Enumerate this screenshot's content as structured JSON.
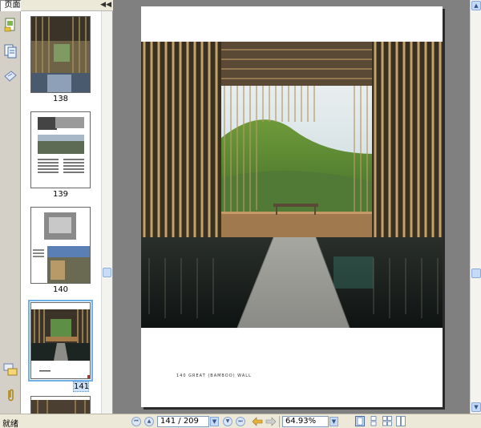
{
  "panel": {
    "tab_label": "页面",
    "collapse_glyph": "◀◀"
  },
  "sidebar_icons": [
    "pages-icon",
    "bookmarks-icon",
    "signatures-icon",
    "comments-icon",
    "attachments-icon"
  ],
  "thumbnails": [
    {
      "label": "138"
    },
    {
      "label": "139"
    },
    {
      "label": "140"
    },
    {
      "label": "141",
      "selected": true
    }
  ],
  "page": {
    "caption": "140 GREAT (BAMBOO) WALL"
  },
  "statusbar": {
    "status": "就绪",
    "page_field": "141 / 209",
    "zoom_field": "64.93%"
  },
  "colors": {
    "chrome": "#ece9d8",
    "doc_background": "#808080",
    "selection": "#6fb0e8"
  }
}
